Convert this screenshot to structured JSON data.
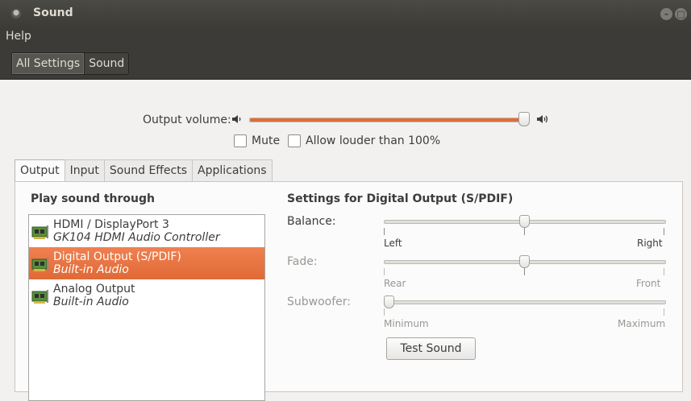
{
  "window": {
    "title": "Sound"
  },
  "menu": {
    "help": "Help"
  },
  "toolbar": {
    "crumbs": [
      "All Settings",
      "Sound"
    ]
  },
  "volume": {
    "label": "Output volume:",
    "level": 1.0,
    "mute_label": "Mute",
    "mute_checked": false,
    "louder_label": "Allow louder than 100%",
    "louder_checked": false
  },
  "tabs": [
    "Output",
    "Input",
    "Sound Effects",
    "Applications"
  ],
  "output": {
    "list_heading": "Play sound through",
    "devices": [
      {
        "name": "HDMI / DisplayPort 3",
        "sub": "GK104 HDMI Audio Controller",
        "selected": false
      },
      {
        "name": "Digital Output (S/PDIF)",
        "sub": "Built-in Audio",
        "selected": true
      },
      {
        "name": "Analog Output",
        "sub": "Built-in Audio",
        "selected": false
      }
    ],
    "settings_heading": "Settings for Digital Output (S/PDIF)",
    "balance": {
      "label": "Balance:",
      "left": "Left",
      "right": "Right",
      "value": 0.5
    },
    "fade": {
      "label": "Fade:",
      "left": "Rear",
      "right": "Front",
      "value": 0.5
    },
    "subwoofer": {
      "label": "Subwoofer:",
      "left": "Minimum",
      "right": "Maximum",
      "value": 0.0
    },
    "test_button": "Test Sound"
  },
  "colors": {
    "accent": "#e06a36",
    "titlebar": "#3c3b37"
  },
  "icons": [
    "speaker-low-icon",
    "speaker-high-icon",
    "sound-card-icon"
  ]
}
